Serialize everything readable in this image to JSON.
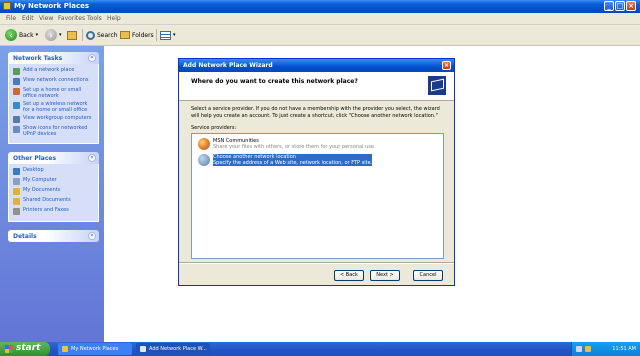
{
  "explorer": {
    "title": "My Network Places",
    "menu": [
      "File",
      "Edit",
      "View",
      "Favorites",
      "Tools",
      "Help"
    ],
    "toolbar": {
      "back": "Back",
      "search": "Search",
      "folders": "Folders"
    }
  },
  "taskpane": {
    "network_tasks": {
      "header": "Network Tasks",
      "items": [
        {
          "label": "Add a network place",
          "icon": "add-network-place-icon"
        },
        {
          "label": "View network connections",
          "icon": "network-connections-icon"
        },
        {
          "label": "Set up a home or small office network",
          "icon": "home-network-icon"
        },
        {
          "label": "Set up a wireless network for a home or small office",
          "icon": "wireless-network-icon"
        },
        {
          "label": "View workgroup computers",
          "icon": "workgroup-computers-icon"
        },
        {
          "label": "Show icons for networked UPnP devices",
          "icon": "upnp-devices-icon"
        }
      ]
    },
    "other_places": {
      "header": "Other Places",
      "items": [
        {
          "label": "Desktop",
          "icon": "desktop-icon"
        },
        {
          "label": "My Computer",
          "icon": "my-computer-icon"
        },
        {
          "label": "My Documents",
          "icon": "my-documents-icon"
        },
        {
          "label": "Shared Documents",
          "icon": "shared-documents-icon"
        },
        {
          "label": "Printers and Faxes",
          "icon": "printers-faxes-icon"
        }
      ]
    },
    "details": {
      "header": "Details"
    }
  },
  "wizard": {
    "title": "Add Network Place Wizard",
    "question": "Where do you want to create this network place?",
    "description": "Select a service provider. If you do not have a membership with the provider you select, the wizard will help you create an account. To just create a shortcut, click \"Choose another network location.\"",
    "providers_label": "Service providers:",
    "providers": [
      {
        "name": "MSN Communities",
        "description": "Share your files with others, or store them for your personal use."
      },
      {
        "name": "Choose another network location",
        "description": "Specify the address of a Web site, network location, or FTP site."
      }
    ],
    "buttons": {
      "back": "< Back",
      "next": "Next >",
      "cancel": "Cancel"
    }
  },
  "taskbar": {
    "start": "start",
    "items": [
      "My Network Places",
      "Add Network Place W..."
    ],
    "clock": "11:51 AM"
  },
  "colors": {
    "title_blue": "#0050d0",
    "taskpane_blue": "#6375d6",
    "selection": "#316ac5",
    "start_green": "#2f8f2f"
  }
}
